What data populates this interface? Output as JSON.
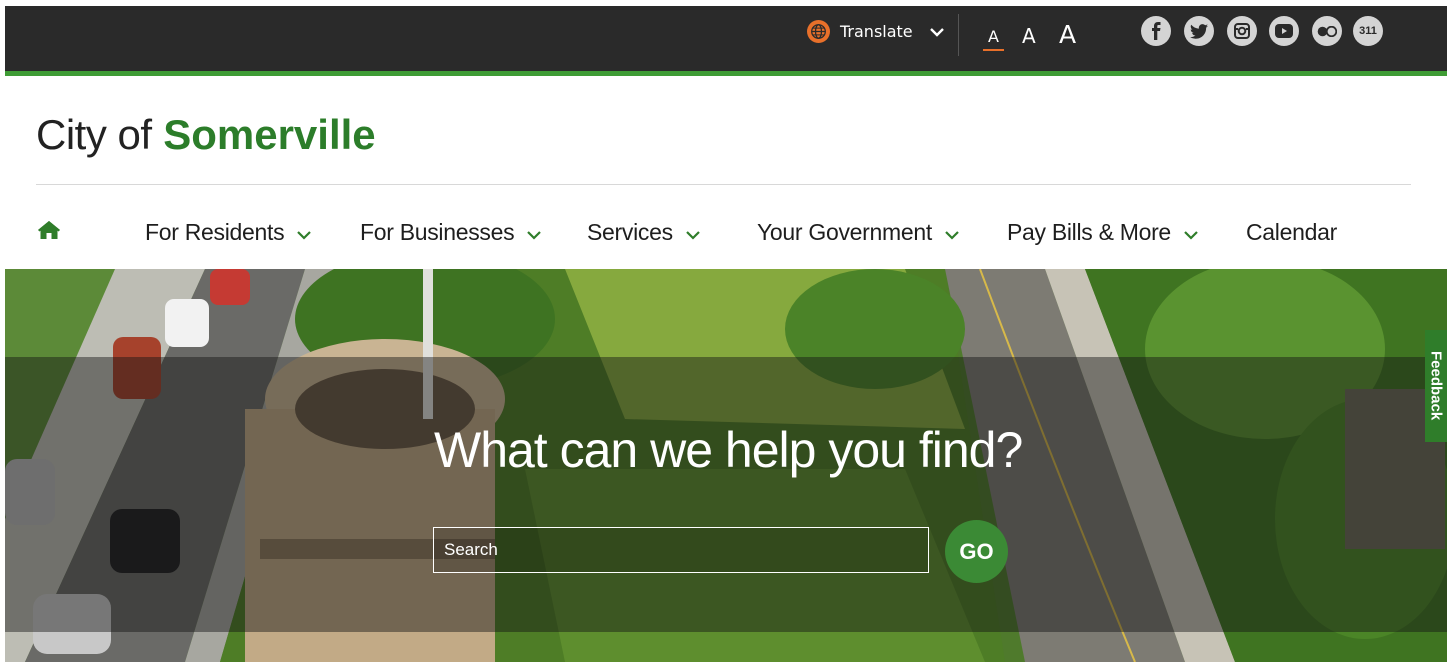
{
  "topbar": {
    "translate_label": "Translate",
    "font_size_labels": [
      "A",
      "A",
      "A"
    ],
    "social": [
      {
        "icon": "facebook-icon"
      },
      {
        "icon": "twitter-icon"
      },
      {
        "icon": "instagram-icon"
      },
      {
        "icon": "youtube-icon"
      },
      {
        "icon": "flickr-icon"
      },
      {
        "icon": "311-icon",
        "label": "311"
      }
    ]
  },
  "logo": {
    "prefix": "City of",
    "name": "Somerville"
  },
  "nav": {
    "items": [
      {
        "label": "For Residents",
        "dropdown": true
      },
      {
        "label": "For Businesses",
        "dropdown": true
      },
      {
        "label": "Services",
        "dropdown": true
      },
      {
        "label": "Your Government",
        "dropdown": true
      },
      {
        "label": "Pay Bills & More",
        "dropdown": true
      },
      {
        "label": "Calendar",
        "dropdown": false
      }
    ]
  },
  "hero": {
    "headline": "What can we help you find?",
    "search_placeholder": "Search",
    "go_label": "GO"
  },
  "feedback_label": "Feedback",
  "colors": {
    "brand_green": "#2c7d2a",
    "accent_orange": "#e8702a",
    "topbar_bg": "#2a2a2a"
  }
}
